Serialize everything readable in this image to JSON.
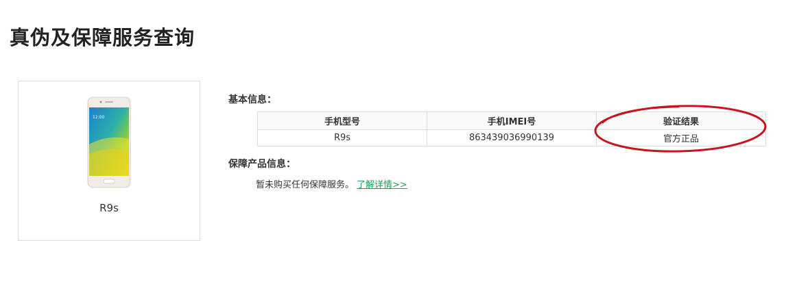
{
  "page": {
    "title": "真伪及保障服务查询"
  },
  "product": {
    "name": "R9s"
  },
  "basic_info": {
    "label": "基本信息：",
    "headers": [
      "手机型号",
      "手机IMEI号",
      "验证结果"
    ],
    "row": [
      "R9s",
      "863439036990139",
      "官方正品"
    ]
  },
  "warranty": {
    "label": "保障产品信息：",
    "text": "暂未购买任何保障服务。",
    "link_text": "了解详情>>"
  },
  "colors": {
    "link": "#19a05a",
    "highlight_circle": "#c8141e",
    "border": "#dddddd"
  }
}
